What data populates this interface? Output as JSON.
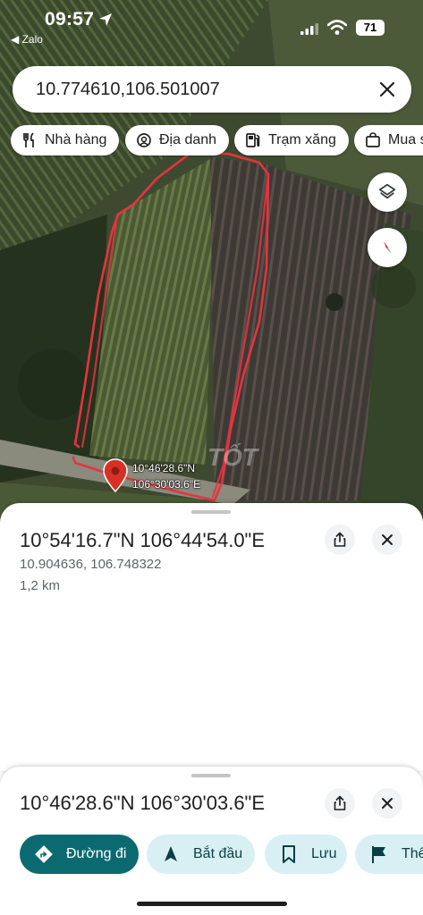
{
  "status_bar": {
    "time": "09:57",
    "back_label": "◀ Zalo",
    "battery": "71"
  },
  "search": {
    "query": "10.774610,106.501007"
  },
  "chips": [
    {
      "label": "Nhà hàng",
      "icon": "restaurant-icon"
    },
    {
      "label": "Địa danh",
      "icon": "landmark-icon"
    },
    {
      "label": "Trạm xăng",
      "icon": "gas-station-icon"
    },
    {
      "label": "Mua s",
      "icon": "shopping-bag-icon"
    }
  ],
  "map": {
    "pin_label_line1": "10°46'28.6\"N",
    "pin_label_line2": "106°30'03.6\"E",
    "watermark": "TỐT",
    "boundary_color": "#e8333f"
  },
  "sheet_top": {
    "title": "10°54'16.7\"N 106°44'54.0\"E",
    "decimal": "10.904636, 106.748322",
    "distance": "1,2 km"
  },
  "sheet_bottom": {
    "title": "10°46'28.6\"N 106°30'03.6\"E",
    "actions": [
      {
        "label": "Đường đi",
        "icon": "directions-icon"
      },
      {
        "label": "Bắt đầu",
        "icon": "navigation-arrow-icon"
      },
      {
        "label": "Lưu",
        "icon": "bookmark-icon"
      },
      {
        "label": "Thê",
        "icon": "flag-icon"
      }
    ]
  },
  "colors": {
    "primary_action": "#0b6a70",
    "secondary_action": "#d8f0f3",
    "pin": "#d93025"
  }
}
